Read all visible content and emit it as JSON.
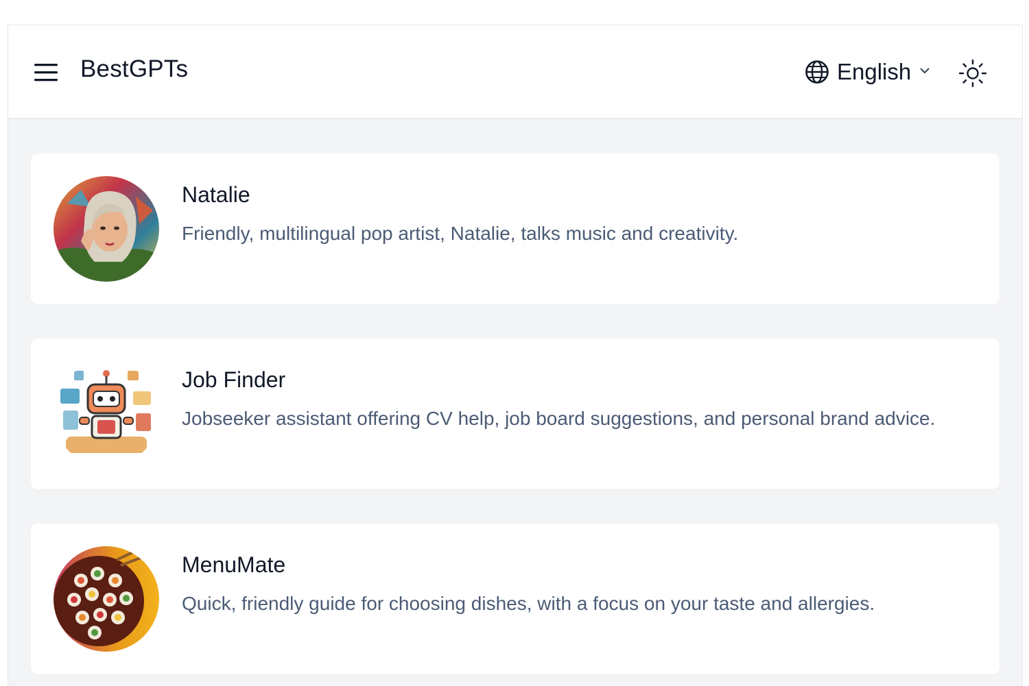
{
  "header": {
    "brand": "BestGPTs",
    "language": "English",
    "menu_icon": "hamburger-menu-icon",
    "globe_icon": "globe-icon",
    "chevron_icon": "chevron-down-icon",
    "theme_icon": "sun-icon"
  },
  "gpts": [
    {
      "name": "Natalie",
      "description": "Friendly, multilingual pop artist, Natalie, talks music and creativity."
    },
    {
      "name": "Job Finder",
      "description": "Jobseeker assistant offering CV help, job board suggestions, and personal brand advice."
    },
    {
      "name": "MenuMate",
      "description": "Quick, friendly guide for choosing dishes, with a focus on your taste and allergies."
    }
  ],
  "colors": {
    "page_bg": "#f3f4f6",
    "card_bg": "#ffffff",
    "title_text": "#111827",
    "desc_text": "#4b5b74"
  }
}
